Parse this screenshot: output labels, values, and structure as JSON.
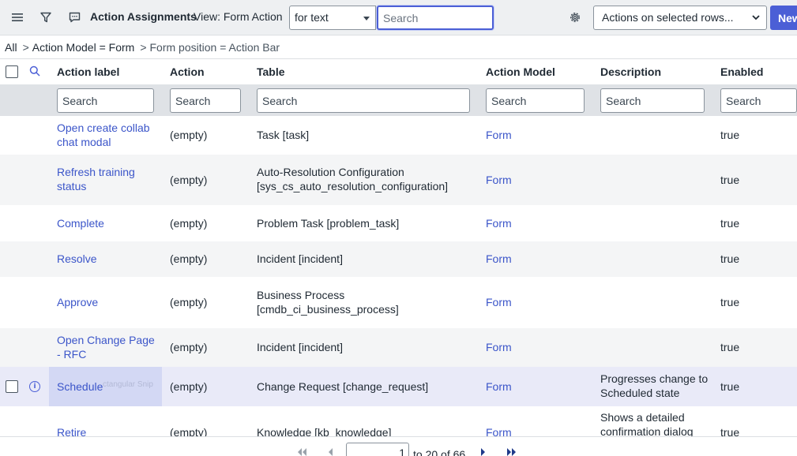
{
  "header": {
    "menu_icon": "hamburger-menu-icon",
    "filter_icon": "funnel-filter-icon",
    "chat_icon": "speech-bubble-icon",
    "title": "Action Assignments",
    "view_label": "View: Form Action",
    "search_field_select": "for text",
    "search_placeholder": "Search",
    "settings_icon": "gear-icon",
    "actions_select": "Actions on selected rows...",
    "new_button": "New"
  },
  "breadcrumb": {
    "items": [
      "All",
      "Action Model = Form",
      "Form position = Action Bar"
    ],
    "separator": ">"
  },
  "table": {
    "columns": [
      "Action label",
      "Action",
      "Table",
      "Action Model",
      "Description",
      "Enabled"
    ],
    "search_placeholder": "Search",
    "rows": [
      {
        "label": "Open create collab chat modal",
        "action": "(empty)",
        "table": "Task [task]",
        "model": "Form",
        "description": "",
        "enabled": "true"
      },
      {
        "label": "Refresh training status",
        "action": "(empty)",
        "table": "Auto-Resolution Configuration [sys_cs_auto_resolution_configuration]",
        "model": "Form",
        "description": "",
        "enabled": "true"
      },
      {
        "label": "Complete",
        "action": "(empty)",
        "table": "Problem Task [problem_task]",
        "model": "Form",
        "description": "",
        "enabled": "true"
      },
      {
        "label": "Resolve",
        "action": "(empty)",
        "table": "Incident [incident]",
        "model": "Form",
        "description": "",
        "enabled": "true"
      },
      {
        "label": "Approve",
        "action": "(empty)",
        "table": "Business Process [cmdb_ci_business_process]",
        "model": "Form",
        "description": "",
        "enabled": "true"
      },
      {
        "label": "Open Change Page - RFC",
        "action": "(empty)",
        "table": "Incident [incident]",
        "model": "Form",
        "description": "",
        "enabled": "true"
      },
      {
        "label": "Schedule",
        "action": "(empty)",
        "table": "Change Request [change_request]",
        "model": "Form",
        "description": "Progresses change to Scheduled state",
        "enabled": "true",
        "overlay_text": "ctangular Snip"
      },
      {
        "label": "Retire",
        "action": "(empty)",
        "table": "Knowledge [kb_knowledge]",
        "model": "Form",
        "description": "Shows a detailed confirmation dialog",
        "enabled": "true"
      }
    ]
  },
  "pager": {
    "first_icon": "first-page-icon",
    "prev_icon": "previous-page-icon",
    "next_icon": "next-page-icon",
    "last_icon": "last-page-icon",
    "current": "1",
    "range_text": "to 20 of 66"
  },
  "colors": {
    "accent": "#4b5fd6",
    "link": "#3b55c9",
    "header_bg": "#eef0f2",
    "search_row_bg": "#dfe2e6",
    "highlight_row_bg": "#e9eaf8"
  }
}
